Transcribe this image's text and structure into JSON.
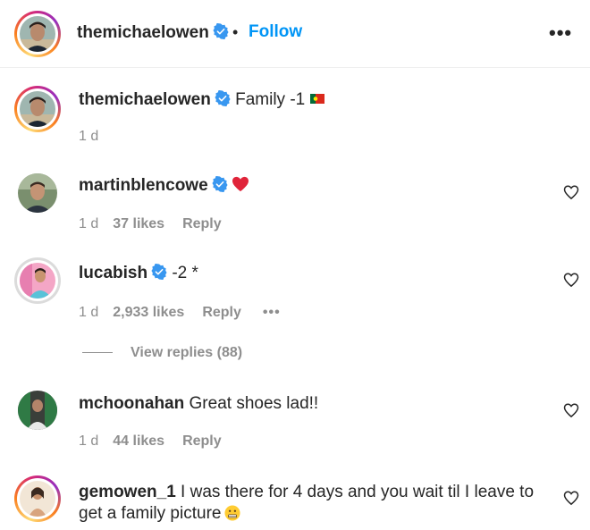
{
  "header": {
    "username": "themichaelowen",
    "separator": "•",
    "follow_label": "Follow",
    "more_label": "•••"
  },
  "caption": {
    "username": "themichaelowen",
    "text": "Family -1",
    "time": "1 d"
  },
  "comments": [
    {
      "username": "martinblencowe",
      "text": "",
      "time": "1 d",
      "likes": "37 likes",
      "reply": "Reply"
    },
    {
      "username": "lucabish",
      "text": "-2 *",
      "time": "1 d",
      "likes": "2,933 likes",
      "reply": "Reply",
      "more": "•••",
      "view_replies": "View replies (88)"
    },
    {
      "username": "mchoonahan",
      "text": "Great shoes lad!!",
      "time": "1 d",
      "likes": "44 likes",
      "reply": "Reply"
    },
    {
      "username": "gemowen_1",
      "text": "I was there for 4 days and you wait til I leave to get a family picture"
    }
  ],
  "colors": {
    "accent": "#0095f6",
    "verified": "#3897f0",
    "muted": "#8e8e8e"
  },
  "icons": [
    "verified-badge-icon",
    "heart-outline-icon",
    "portugal-flag-icon",
    "red-heart-emoji",
    "grimace-emoji",
    "more-options-icon"
  ]
}
